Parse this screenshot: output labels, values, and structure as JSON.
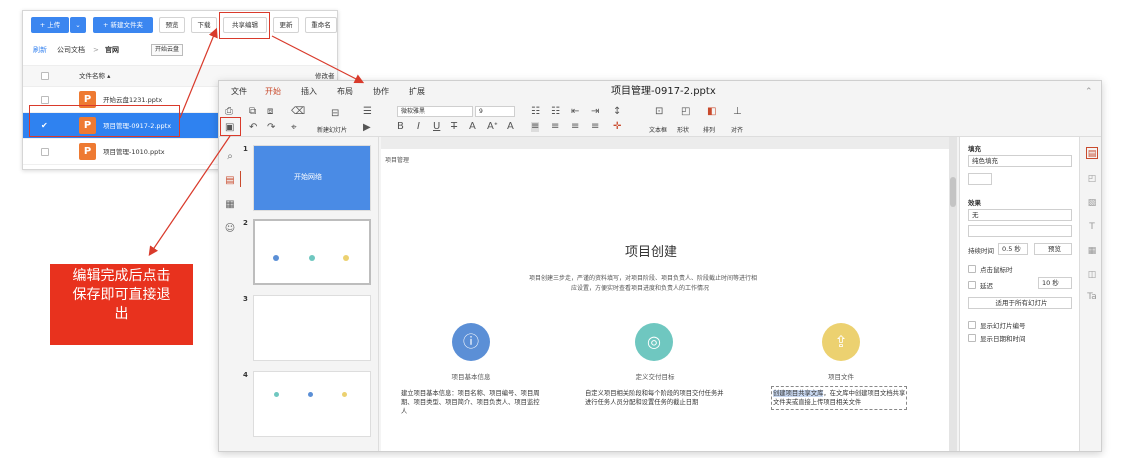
{
  "file_manager": {
    "toolbar": {
      "upload": "+ 上传",
      "new_folder": "+ 新建文件夹",
      "preview": "预览",
      "download": "下载",
      "share_edit": "共享编辑",
      "update": "更新",
      "rename": "重命名"
    },
    "breadcrumb": {
      "refresh": "刷新",
      "level1": "公司文档",
      "sep": ">",
      "level2": "官网",
      "tag": "开始云盘"
    },
    "table": {
      "col_name": "文件名称",
      "col_modifier": "修改者",
      "rows": [
        {
          "name": "开始云盘1231.pptx",
          "icon": "P",
          "selected": false
        },
        {
          "name": "项目管理-0917-2.pptx",
          "icon": "P",
          "selected": true
        },
        {
          "name": "项目管理-1010.pptx",
          "icon": "P",
          "selected": false
        }
      ]
    }
  },
  "editor": {
    "title": "项目管理-0917-2.pptx",
    "menu": [
      "文件",
      "开始",
      "插入",
      "布局",
      "协作",
      "扩展"
    ],
    "active_menu": "开始",
    "ribbon": {
      "new_slide": "新建幻灯片",
      "font_name": "微软雅黑",
      "font_size": "9",
      "textbox": "文本框",
      "shape": "形状",
      "arrange": "排列",
      "align": "对齐"
    },
    "thumbnails": [
      {
        "num": "1",
        "text": "开始网络"
      },
      {
        "num": "2",
        "text": ""
      },
      {
        "num": "3",
        "text": ""
      },
      {
        "num": "4",
        "text": ""
      }
    ],
    "slide": {
      "breadcrumb": "项目管理",
      "title": "项目创建",
      "subtitle_line1": "项目创建三步走，严谨的资料填写，对项目阶段、项目负责人、阶段截止时间等进行相",
      "subtitle_line2": "应设置，方便实时查看项目进度和负责人的工作情况",
      "features": [
        {
          "title": "项目基本信息",
          "desc": "建立项目基本信息：项目名称、项目编号、项目周期、项目类型、项目简介、项目负责人、项目监控人",
          "color": "#5b8fd6",
          "icon": "info-icon"
        },
        {
          "title": "定义交付目标",
          "desc": "自定义项目相关阶段和每个阶段的项目交付任务并进行任务人员分配和设置任务的截止日期",
          "color": "#6fc7c0",
          "icon": "target-icon"
        },
        {
          "title": "项目文件",
          "desc": "创建项目共享文库，在文库中创建项目文档共享文件夹或直接上传项目相关文件",
          "highlight": "创建项目共享文库",
          "color": "#ecd170",
          "icon": "share-icon"
        }
      ]
    },
    "panel": {
      "fill_label": "填充",
      "fill_value": "纯色填充",
      "effect_label": "效果",
      "effect_value": "无",
      "duration_label": "持续时间",
      "duration_value": "0.5 秒",
      "preview": "预览",
      "click_label": "点击鼠标时",
      "delay_label": "延迟",
      "delay_value": "10 秒",
      "apply_all": "适用于所有幻灯片",
      "show_number": "显示幻灯片编号",
      "show_datetime": "显示日期和时间"
    }
  },
  "callout": {
    "text": "编辑完成后点击保存即可直接退出"
  },
  "colors": {
    "primary_blue": "#3b86f0",
    "annotation_red": "#d93a2b",
    "file_icon_orange": "#ee7a32",
    "callout_red": "#e8321e"
  }
}
